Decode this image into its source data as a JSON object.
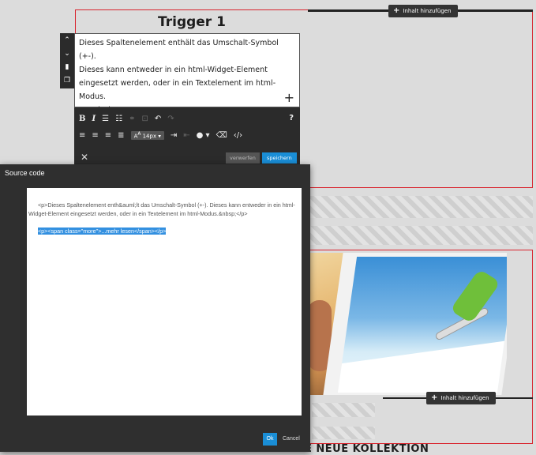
{
  "page": {
    "trigger_title": "Trigger 1",
    "add_content_label": "Inhalt hinzufügen",
    "bottom_heading": "ENTDECKE UNSERE NEUE KOLLEKTION"
  },
  "editor": {
    "side_icons": [
      "chevron-up-icon",
      "chevron-down-icon",
      "trash-icon",
      "copy-icon"
    ],
    "content": {
      "line1": "Dieses Spaltenelement enthält das Umschalt-Symbol (+-).",
      "line2": "Dieses kann entweder in ein html-Widget-Element",
      "line3": "eingesetzt werden, oder in ein Textelement im html-",
      "line4": "Modus.",
      "more": "...mehr lesen",
      "plus": "+"
    },
    "toolbar": {
      "bold": "B",
      "italic": "I",
      "font_size": "14px",
      "help": "?",
      "close": "✕",
      "discard": "verwerfen",
      "save": "speichern"
    }
  },
  "dialog": {
    "title": "Source code",
    "code_line1": "<p>Dieses Spaltenelement enth&auml;lt das Umschalt-Symbol (+-). Dieses kann entweder in ein html-Widget-Element eingesetzt werden, oder in ein Textelement im html-Modus.&nbsp;</p>",
    "code_line2": "<p><span class=\"more\">...mehr lesen</span></p>",
    "ok": "Ok",
    "cancel": "Cancel"
  },
  "colors": {
    "accent": "#1a8ed6",
    "frame_red": "#d9232d",
    "toolbar": "#2b2b2b"
  }
}
